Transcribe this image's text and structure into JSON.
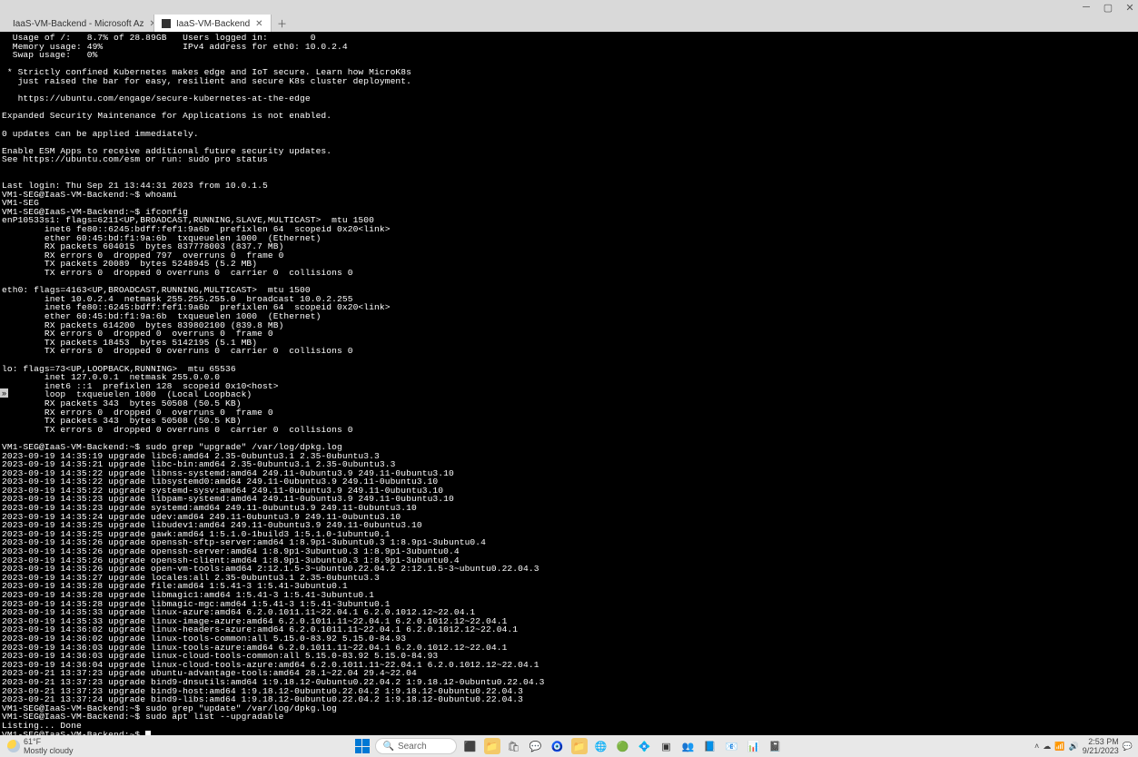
{
  "browser": {
    "tabs": [
      {
        "title": "IaaS-VM-Backend - Microsoft Az",
        "active": false
      },
      {
        "title": "IaaS-VM-Backend",
        "active": true
      }
    ],
    "url": "bst-cae4c589-7cdf-4356-b785-bea45f90f72a.bastion.azure.com/#/client/SWFhUy1WTS1CYWNrZW5kAGMAYmlmcm9zdA==?trustedAuthority=https%3A%2F%2Fhybridnetworking.hosting.portal.azure.net"
  },
  "terminal": {
    "lines": [
      "  Usage of /:   8.7% of 28.89GB   Users logged in:        0",
      "  Memory usage: 49%               IPv4 address for eth0: 10.0.2.4",
      "  Swap usage:   0%",
      "",
      " * Strictly confined Kubernetes makes edge and IoT secure. Learn how MicroK8s",
      "   just raised the bar for easy, resilient and secure K8s cluster deployment.",
      "",
      "   https://ubuntu.com/engage/secure-kubernetes-at-the-edge",
      "",
      "Expanded Security Maintenance for Applications is not enabled.",
      "",
      "0 updates can be applied immediately.",
      "",
      "Enable ESM Apps to receive additional future security updates.",
      "See https://ubuntu.com/esm or run: sudo pro status",
      "",
      "",
      "Last login: Thu Sep 21 13:44:31 2023 from 10.0.1.5",
      "VM1-SEG@IaaS-VM-Backend:~$ whoami",
      "VM1-SEG",
      "VM1-SEG@IaaS-VM-Backend:~$ ifconfig",
      "enP10533s1: flags=6211<UP,BROADCAST,RUNNING,SLAVE,MULTICAST>  mtu 1500",
      "        inet6 fe80::6245:bdff:fef1:9a6b  prefixlen 64  scopeid 0x20<link>",
      "        ether 60:45:bd:f1:9a:6b  txqueuelen 1000  (Ethernet)",
      "        RX packets 604015  bytes 837778003 (837.7 MB)",
      "        RX errors 0  dropped 797  overruns 0  frame 0",
      "        TX packets 20089  bytes 5248945 (5.2 MB)",
      "        TX errors 0  dropped 0 overruns 0  carrier 0  collisions 0",
      "",
      "eth0: flags=4163<UP,BROADCAST,RUNNING,MULTICAST>  mtu 1500",
      "        inet 10.0.2.4  netmask 255.255.255.0  broadcast 10.0.2.255",
      "        inet6 fe80::6245:bdff:fef1:9a6b  prefixlen 64  scopeid 0x20<link>",
      "        ether 60:45:bd:f1:9a:6b  txqueuelen 1000  (Ethernet)",
      "        RX packets 614200  bytes 839802100 (839.8 MB)",
      "        RX errors 0  dropped 0  overruns 0  frame 0",
      "        TX packets 18453  bytes 5142195 (5.1 MB)",
      "        TX errors 0  dropped 0 overruns 0  carrier 0  collisions 0",
      "",
      "lo: flags=73<UP,LOOPBACK,RUNNING>  mtu 65536",
      "        inet 127.0.0.1  netmask 255.0.0.0",
      "        inet6 ::1  prefixlen 128  scopeid 0x10<host>",
      "        loop  txqueuelen 1000  (Local Loopback)",
      "        RX packets 343  bytes 50508 (50.5 KB)",
      "        RX errors 0  dropped 0  overruns 0  frame 0",
      "        TX packets 343  bytes 50508 (50.5 KB)",
      "        TX errors 0  dropped 0 overruns 0  carrier 0  collisions 0",
      "",
      "VM1-SEG@IaaS-VM-Backend:~$ sudo grep \"upgrade\" /var/log/dpkg.log",
      "2023-09-19 14:35:19 upgrade libc6:amd64 2.35-0ubuntu3.1 2.35-0ubuntu3.3",
      "2023-09-19 14:35:21 upgrade libc-bin:amd64 2.35-0ubuntu3.1 2.35-0ubuntu3.3",
      "2023-09-19 14:35:22 upgrade libnss-systemd:amd64 249.11-0ubuntu3.9 249.11-0ubuntu3.10",
      "2023-09-19 14:35:22 upgrade libsystemd0:amd64 249.11-0ubuntu3.9 249.11-0ubuntu3.10",
      "2023-09-19 14:35:22 upgrade systemd-sysv:amd64 249.11-0ubuntu3.9 249.11-0ubuntu3.10",
      "2023-09-19 14:35:23 upgrade libpam-systemd:amd64 249.11-0ubuntu3.9 249.11-0ubuntu3.10",
      "2023-09-19 14:35:23 upgrade systemd:amd64 249.11-0ubuntu3.9 249.11-0ubuntu3.10",
      "2023-09-19 14:35:24 upgrade udev:amd64 249.11-0ubuntu3.9 249.11-0ubuntu3.10",
      "2023-09-19 14:35:25 upgrade libudev1:amd64 249.11-0ubuntu3.9 249.11-0ubuntu3.10",
      "2023-09-19 14:35:25 upgrade gawk:amd64 1:5.1.0-1build3 1:5.1.0-1ubuntu0.1",
      "2023-09-19 14:35:26 upgrade openssh-sftp-server:amd64 1:8.9p1-3ubuntu0.3 1:8.9p1-3ubuntu0.4",
      "2023-09-19 14:35:26 upgrade openssh-server:amd64 1:8.9p1-3ubuntu0.3 1:8.9p1-3ubuntu0.4",
      "2023-09-19 14:35:26 upgrade openssh-client:amd64 1:8.9p1-3ubuntu0.3 1:8.9p1-3ubuntu0.4",
      "2023-09-19 14:35:26 upgrade open-vm-tools:amd64 2:12.1.5-3~ubuntu0.22.04.2 2:12.1.5-3~ubuntu0.22.04.3",
      "2023-09-19 14:35:27 upgrade locales:all 2.35-0ubuntu3.1 2.35-0ubuntu3.3",
      "2023-09-19 14:35:28 upgrade file:amd64 1:5.41-3 1:5.41-3ubuntu0.1",
      "2023-09-19 14:35:28 upgrade libmagic1:amd64 1:5.41-3 1:5.41-3ubuntu0.1",
      "2023-09-19 14:35:28 upgrade libmagic-mgc:amd64 1:5.41-3 1:5.41-3ubuntu0.1",
      "2023-09-19 14:35:33 upgrade linux-azure:amd64 6.2.0.1011.11~22.04.1 6.2.0.1012.12~22.04.1",
      "2023-09-19 14:35:33 upgrade linux-image-azure:amd64 6.2.0.1011.11~22.04.1 6.2.0.1012.12~22.04.1",
      "2023-09-19 14:36:02 upgrade linux-headers-azure:amd64 6.2.0.1011.11~22.04.1 6.2.0.1012.12~22.04.1",
      "2023-09-19 14:36:02 upgrade linux-tools-common:all 5.15.0-83.92 5.15.0-84.93",
      "2023-09-19 14:36:03 upgrade linux-tools-azure:amd64 6.2.0.1011.11~22.04.1 6.2.0.1012.12~22.04.1",
      "2023-09-19 14:36:03 upgrade linux-cloud-tools-common:all 5.15.0-83.92 5.15.0-84.93",
      "2023-09-19 14:36:04 upgrade linux-cloud-tools-azure:amd64 6.2.0.1011.11~22.04.1 6.2.0.1012.12~22.04.1",
      "2023-09-21 13:37:23 upgrade ubuntu-advantage-tools:amd64 28.1~22.04 29.4~22.04",
      "2023-09-21 13:37:23 upgrade bind9-dnsutils:amd64 1:9.18.12-0ubuntu0.22.04.2 1:9.18.12-0ubuntu0.22.04.3",
      "2023-09-21 13:37:23 upgrade bind9-host:amd64 1:9.18.12-0ubuntu0.22.04.2 1:9.18.12-0ubuntu0.22.04.3",
      "2023-09-21 13:37:24 upgrade bind9-libs:amd64 1:9.18.12-0ubuntu0.22.04.2 1:9.18.12-0ubuntu0.22.04.3",
      "VM1-SEG@IaaS-VM-Backend:~$ sudo grep \"update\" /var/log/dpkg.log",
      "VM1-SEG@IaaS-VM-Backend:~$ sudo apt list --upgradable",
      "Listing... Done",
      "VM1-SEG@IaaS-VM-Backend:~$ "
    ]
  },
  "taskbar": {
    "weather_temp": "61°F",
    "weather_desc": "Mostly cloudy",
    "search_placeholder": "Search",
    "time": "2:53 PM",
    "date": "9/21/2023"
  }
}
